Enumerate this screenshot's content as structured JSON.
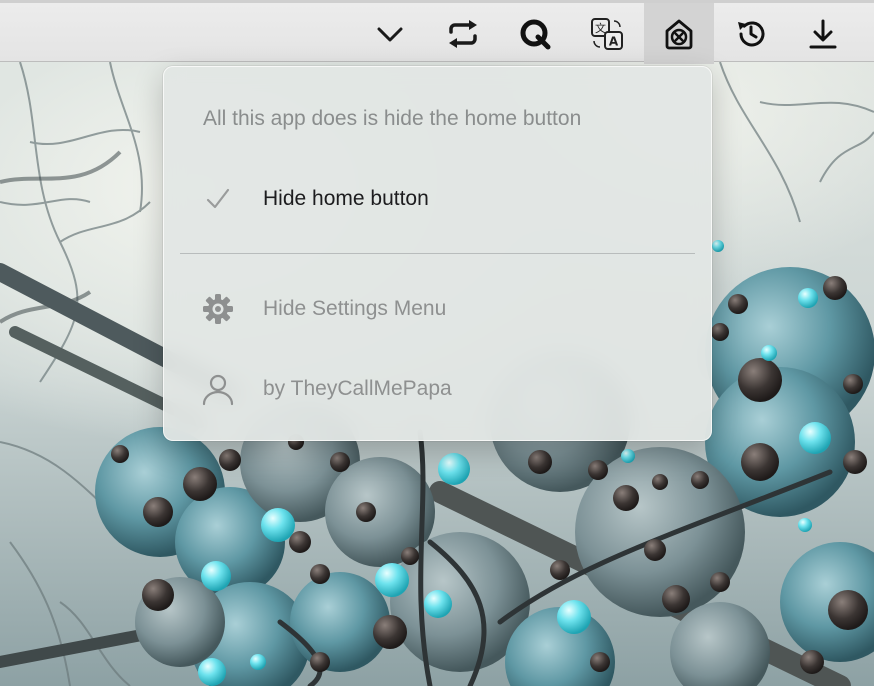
{
  "toolbar": {
    "buttons": [
      {
        "name": "chevron-down",
        "icon": "chevron-down-icon"
      },
      {
        "name": "repeat",
        "icon": "repeat-icon"
      },
      {
        "name": "q",
        "icon": "q-logo-icon"
      },
      {
        "name": "translate",
        "icon": "translate-icon"
      },
      {
        "name": "hide-home",
        "icon": "home-x-icon",
        "active": true
      },
      {
        "name": "history",
        "icon": "history-icon"
      },
      {
        "name": "download",
        "icon": "download-icon"
      }
    ]
  },
  "popover": {
    "header": "All this app does is hide the home button",
    "items": [
      {
        "label": "Hide home button",
        "icon": "checkmark-icon",
        "checked": true
      },
      {
        "label": "Hide Settings Menu",
        "icon": "gear-icon"
      },
      {
        "label": "by TheyCallMePapa",
        "icon": "person-icon"
      }
    ]
  }
}
